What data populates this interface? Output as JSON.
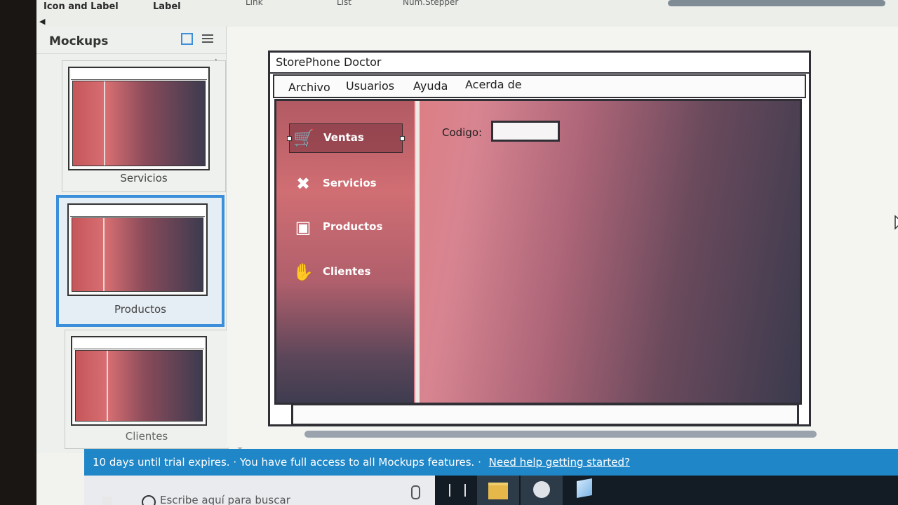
{
  "toolbar": {
    "items": [
      "Icon and Label",
      "Label",
      "Link",
      "List",
      "Num.Stepper"
    ]
  },
  "panel": {
    "title": "Mockups",
    "thumbs": [
      {
        "caption": "Servicios"
      },
      {
        "caption": "Productos"
      },
      {
        "caption": "Clientes"
      }
    ]
  },
  "mockup": {
    "title": "StorePhone Doctor",
    "menu": [
      "Archivo",
      "Usuarios",
      "Ayuda",
      "Acerda de"
    ],
    "nav": [
      {
        "label": "Ventas",
        "icon": "cart-icon"
      },
      {
        "label": "Servicios",
        "icon": "tools-icon"
      },
      {
        "label": "Productos",
        "icon": "box-icon"
      },
      {
        "label": "Clientes",
        "icon": "handshake-icon"
      }
    ],
    "codigo_label": "Codigo:"
  },
  "trial": {
    "message": "10 days until trial expires. · You have full access to all Mockups features. ·",
    "link": "Need help getting started?"
  },
  "taskbar": {
    "search_placeholder": "Escribe aquí para buscar"
  },
  "colors": {
    "accent": "#3b8fda",
    "banner": "#1f86c7",
    "gradient_start": "#c85b61",
    "gradient_end": "#3b3a4d"
  }
}
